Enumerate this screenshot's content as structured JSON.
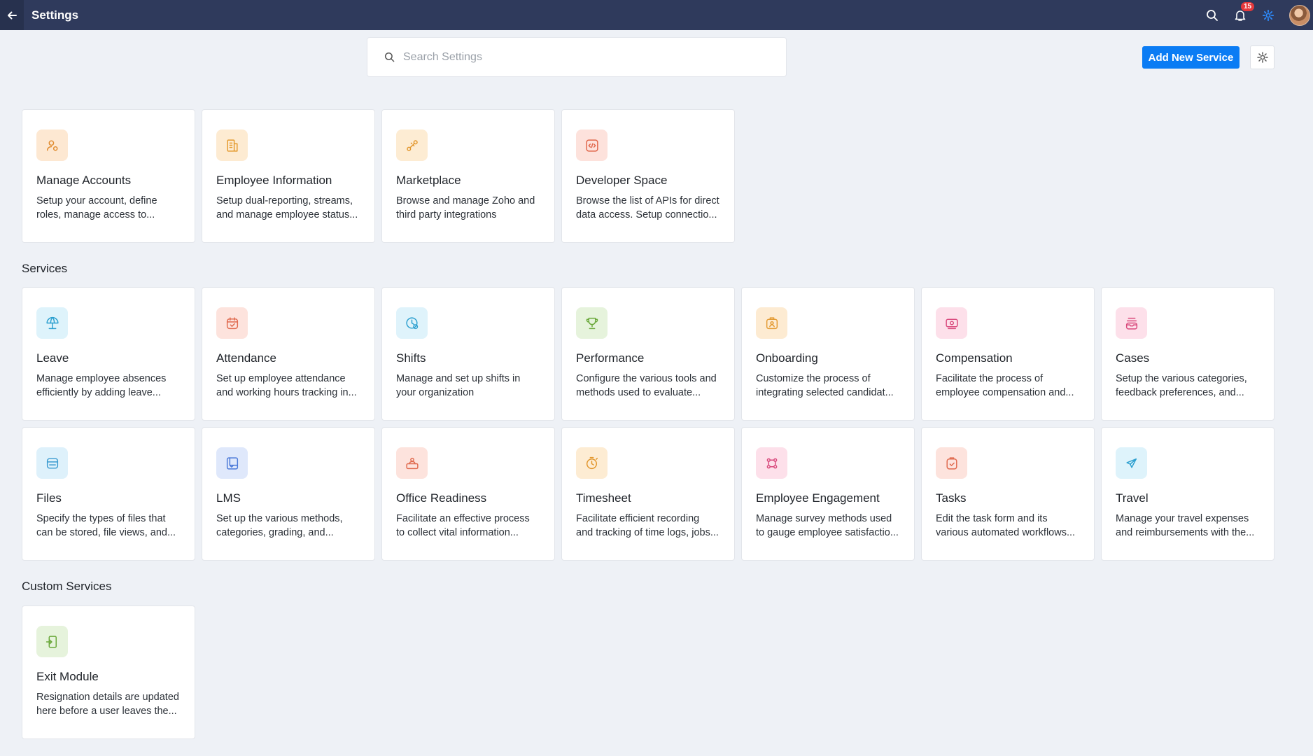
{
  "header": {
    "title": "Settings",
    "notification_count": "15"
  },
  "search": {
    "placeholder": "Search Settings"
  },
  "actions": {
    "add_service_label": "Add New Service"
  },
  "general": [
    {
      "title": "Manage Accounts",
      "desc1": "Setup your account, define",
      "desc2": "roles, manage access to...",
      "icon": "manage-accounts-icon",
      "bg": "#fde8d2",
      "fg": "#e08a2c"
    },
    {
      "title": "Employee Information",
      "desc1": "Setup dual-reporting, streams,",
      "desc2": "and manage employee status...",
      "icon": "employee-information-icon",
      "bg": "#fdebd2",
      "fg": "#e49a2e"
    },
    {
      "title": "Marketplace",
      "desc1": "Browse and manage Zoho and",
      "desc2": "third party integrations",
      "icon": "marketplace-icon",
      "bg": "#fdecd3",
      "fg": "#e2962c"
    },
    {
      "title": "Developer Space",
      "desc1": "Browse the list of APIs for direct",
      "desc2": "data access. Setup connectio...",
      "icon": "developer-space-icon",
      "bg": "#fde2dc",
      "fg": "#e0654a"
    }
  ],
  "services_heading": "Services",
  "services": [
    {
      "title": "Leave",
      "desc1": "Manage employee absences",
      "desc2": "efficiently by adding leave...",
      "icon": "leave-umbrella-icon",
      "bg": "#def3fb",
      "fg": "#2b9fcf"
    },
    {
      "title": "Attendance",
      "desc1": "Set up employee attendance",
      "desc2": "and working hours tracking in...",
      "icon": "attendance-calendar-icon",
      "bg": "#fde3dd",
      "fg": "#e06a4e"
    },
    {
      "title": "Shifts",
      "desc1": "Manage and set up shifts in",
      "desc2": "your organization",
      "icon": "shifts-clock-icon",
      "bg": "#dff3fb",
      "fg": "#2b9fcf"
    },
    {
      "title": "Performance",
      "desc1": "Configure the various tools and",
      "desc2": "methods used to evaluate...",
      "icon": "performance-trophy-icon",
      "bg": "#e6f3dc",
      "fg": "#6aa83a"
    },
    {
      "title": "Onboarding",
      "desc1": "Customize the process of",
      "desc2": "integrating selected candidat...",
      "icon": "onboarding-badge-icon",
      "bg": "#fdebd2",
      "fg": "#e39a32"
    },
    {
      "title": "Compensation",
      "desc1": "Facilitate the process of",
      "desc2": "employee compensation and...",
      "icon": "compensation-money-icon",
      "bg": "#fde0ea",
      "fg": "#d9497c"
    },
    {
      "title": "Cases",
      "desc1": "Setup the various categories,",
      "desc2": "feedback preferences, and...",
      "icon": "cases-inbox-icon",
      "bg": "#fde0ea",
      "fg": "#d9497c"
    },
    {
      "title": "Files",
      "desc1": "Specify the types of files that",
      "desc2": "can be stored, file views, and...",
      "icon": "files-folder-icon",
      "bg": "#def1fb",
      "fg": "#3b9bd0"
    },
    {
      "title": "LMS",
      "desc1": "Set up the various methods,",
      "desc2": "categories, grading, and...",
      "icon": "lms-book-icon",
      "bg": "#dfe8fb",
      "fg": "#4a78d8"
    },
    {
      "title": "Office Readiness",
      "desc1": "Facilitate an effective process",
      "desc2": "to collect vital information...",
      "icon": "office-readiness-desk-icon",
      "bg": "#fde3dd",
      "fg": "#e06a4e"
    },
    {
      "title": "Timesheet",
      "desc1": "Facilitate efficient recording",
      "desc2": "and tracking of time logs, jobs...",
      "icon": "timesheet-timer-icon",
      "bg": "#fdecd3",
      "fg": "#e2962c"
    },
    {
      "title": "Employee Engagement",
      "desc1": "Manage survey methods used",
      "desc2": "to gauge employee satisfactio...",
      "icon": "employee-engagement-icon",
      "bg": "#fde0ea",
      "fg": "#d9497c"
    },
    {
      "title": "Tasks",
      "desc1": "Edit the task form and its",
      "desc2": "various automated workflows...",
      "icon": "tasks-clipboard-icon",
      "bg": "#fde3dd",
      "fg": "#e06a4e"
    },
    {
      "title": "Travel",
      "desc1": "Manage your travel expenses",
      "desc2": "and reimbursements with the...",
      "icon": "travel-plane-icon",
      "bg": "#def3fb",
      "fg": "#2b9fcf"
    }
  ],
  "custom_heading": "Custom Services",
  "custom": [
    {
      "title": "Exit Module",
      "desc1": "Resignation details are updated",
      "desc2": "here before a user leaves the...",
      "icon": "exit-module-door-icon",
      "bg": "#e6f3dc",
      "fg": "#6aa83a"
    }
  ]
}
